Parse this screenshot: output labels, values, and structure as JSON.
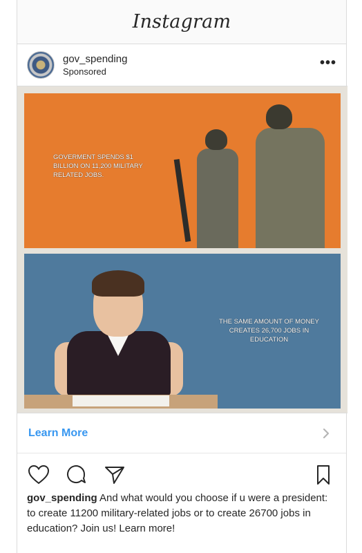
{
  "app": {
    "title": "Instagram"
  },
  "post": {
    "username": "gov_spending",
    "label": "Sponsored",
    "more_icon": "more-dots-icon"
  },
  "media": {
    "top_text": "GOVERMENT SPENDS $1 BILLION ON 11,200 MILITARY RELATED JOBS.",
    "bottom_text": "THE SAME AMOUNT OF MONEY CREATES 26,700 JOBS IN EDUCATION",
    "colors": {
      "top_panel": "#e67c2e",
      "bottom_panel": "#4f7a9d"
    }
  },
  "cta": {
    "label": "Learn More",
    "icon": "chevron-right-icon",
    "color": "#3897f0"
  },
  "actions": {
    "icons": [
      "heart-icon",
      "comment-icon",
      "share-icon",
      "bookmark-icon"
    ]
  },
  "caption": {
    "username": "gov_spending",
    "text": " And what would you choose if u were a president: to create 11200 military-related jobs or to create 26700 jobs in education? Join us! Learn more!"
  }
}
